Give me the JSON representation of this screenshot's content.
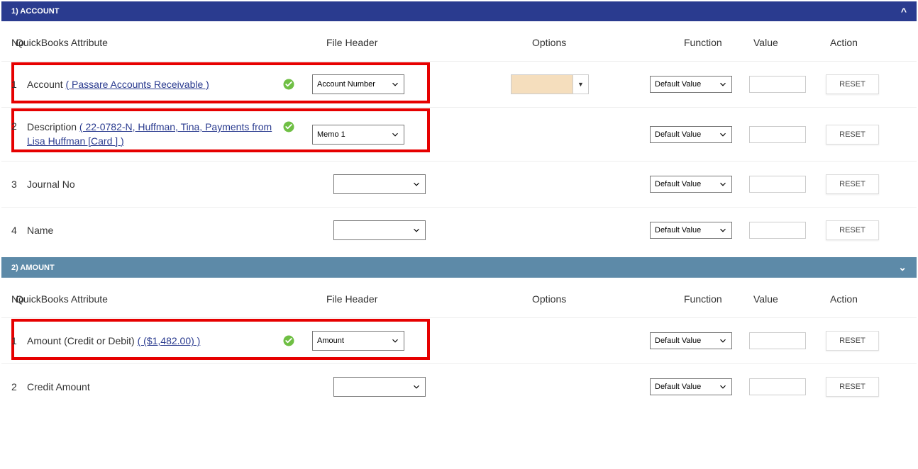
{
  "sections": {
    "account": {
      "title": "1) ACCOUNT"
    },
    "amount": {
      "title": "2) AMOUNT"
    }
  },
  "headers": {
    "no": "No",
    "attribute": "QuickBooks Attribute",
    "file": "File Header",
    "options": "Options",
    "function": "Function",
    "value": "Value",
    "action": "Action"
  },
  "account_rows": [
    {
      "no": "1",
      "label": "Account",
      "detail": "( Passare Accounts Receivable )",
      "file": "Account Number",
      "func": "Default Value",
      "has_check": true,
      "has_option": true,
      "highlighted": true
    },
    {
      "no": "2",
      "label": "Description",
      "detail": "( 22-0782-N, Huffman, Tina, Payments from Lisa Huffman [Card ] )",
      "file": "Memo 1",
      "func": "Default Value",
      "has_check": true,
      "has_option": false,
      "highlighted": true
    },
    {
      "no": "3",
      "label": "Journal No",
      "detail": "",
      "file": "",
      "func": "Default Value",
      "has_check": false,
      "has_option": false,
      "highlighted": false
    },
    {
      "no": "4",
      "label": "Name",
      "detail": "",
      "file": "",
      "func": "Default Value",
      "has_check": false,
      "has_option": false,
      "highlighted": false
    }
  ],
  "amount_rows": [
    {
      "no": "1",
      "label": "Amount (Credit or Debit)",
      "detail": "( ($1,482.00) )",
      "file": "Amount",
      "func": "Default Value",
      "has_check": true,
      "highlighted": true
    },
    {
      "no": "2",
      "label": "Credit Amount",
      "detail": "",
      "file": "",
      "func": "Default Value",
      "has_check": false,
      "highlighted": false
    }
  ],
  "buttons": {
    "reset": "RESET"
  }
}
